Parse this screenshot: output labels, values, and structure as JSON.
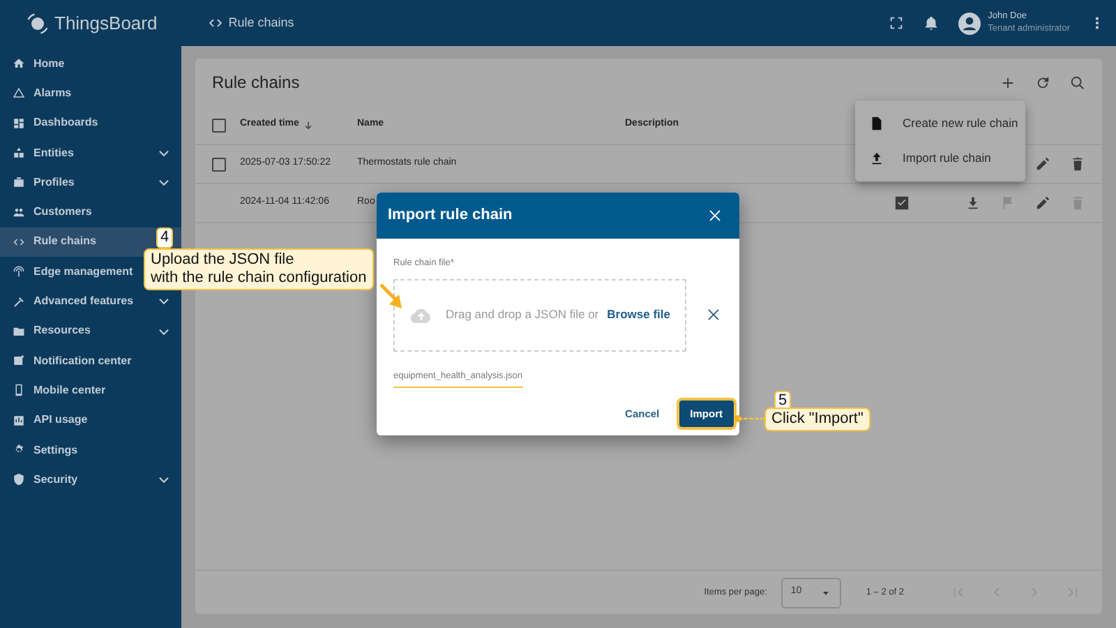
{
  "app": {
    "logo_text": "ThingsBoard"
  },
  "topbar": {
    "breadcrumb": "Rule chains",
    "user": {
      "name": "John Doe",
      "role": "Tenant administrator"
    }
  },
  "sidebar": {
    "items": [
      {
        "label": "Home",
        "expandable": false,
        "selected": false
      },
      {
        "label": "Alarms",
        "expandable": false,
        "selected": false
      },
      {
        "label": "Dashboards",
        "expandable": false,
        "selected": false
      },
      {
        "label": "Entities",
        "expandable": true,
        "selected": false
      },
      {
        "label": "Profiles",
        "expandable": true,
        "selected": false
      },
      {
        "label": "Customers",
        "expandable": false,
        "selected": false
      },
      {
        "label": "Rule chains",
        "expandable": false,
        "selected": true
      },
      {
        "label": "Edge management",
        "selected": false
      },
      {
        "label": "Advanced features",
        "expandable": true,
        "selected": false
      },
      {
        "label": "Resources",
        "expandable": true,
        "selected": false
      },
      {
        "label": "Notification center",
        "expandable": false,
        "selected": false
      },
      {
        "label": "Mobile center",
        "expandable": false,
        "selected": false
      },
      {
        "label": "API usage",
        "expandable": false,
        "selected": false
      },
      {
        "label": "Settings",
        "expandable": false,
        "selected": false
      },
      {
        "label": "Security",
        "expandable": true,
        "selected": false
      }
    ]
  },
  "page": {
    "title": "Rule chains",
    "table": {
      "columns": [
        "Created time",
        "Name",
        "Description"
      ],
      "header_checked": false,
      "rows": [
        {
          "created": "2025-07-03 17:50:22",
          "name": "Thermostats rule chain",
          "checked": false,
          "actions": [
            {
              "kind": "edit",
              "disabled": false
            },
            {
              "kind": "delete",
              "disabled": false
            }
          ]
        },
        {
          "created": "2024-11-04 11:42:06",
          "name": "Roo",
          "root": true,
          "actions": [
            {
              "kind": "download",
              "disabled": false
            },
            {
              "kind": "flag",
              "disabled": true
            },
            {
              "kind": "edit",
              "disabled": false
            },
            {
              "kind": "delete",
              "disabled": true
            }
          ]
        }
      ]
    },
    "paginator": {
      "label": "Items per page:",
      "page_size": "10",
      "range": "1 – 2 of 2"
    }
  },
  "menu": {
    "items": [
      {
        "label": "Create new rule chain"
      },
      {
        "label": "Import rule chain"
      }
    ]
  },
  "dialog": {
    "title": "Import rule chain",
    "field_label": "Rule chain file*",
    "drop_text": "Drag and drop a JSON file or",
    "browse_link": "Browse file",
    "file_name": "equipment_health_analysis.json",
    "cancel": "Cancel",
    "import": "Import"
  },
  "callouts": [
    {
      "number": "4",
      "text": "Upload the JSON file\nwith the rule chain configuration"
    },
    {
      "number": "5",
      "text": "Click \"Import\""
    }
  ]
}
